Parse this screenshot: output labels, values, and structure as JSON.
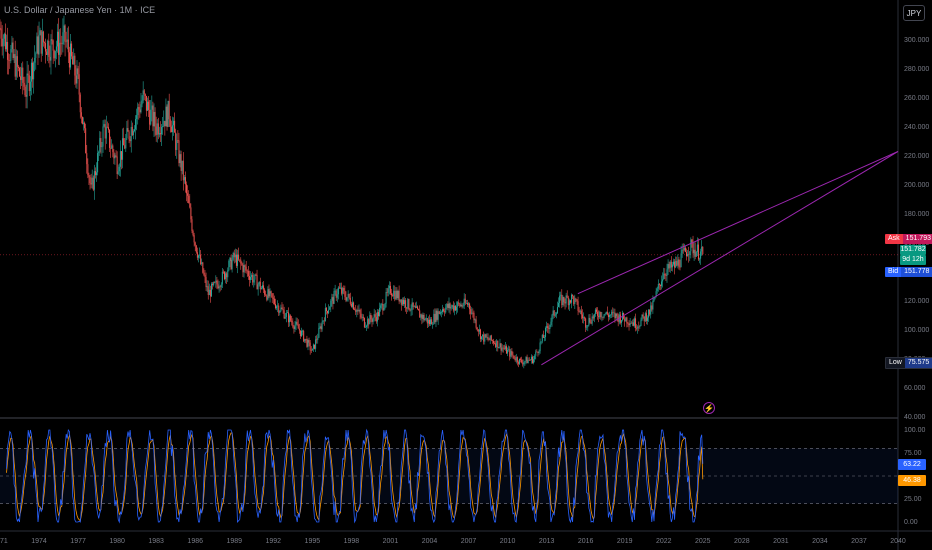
{
  "header": {
    "title": "U.S. Dollar / Japanese Yen · 1M · ICE",
    "currency_button": "JPY"
  },
  "colors": {
    "up": "#26a69a",
    "down": "#ef5350",
    "channel": "#9c27b0",
    "k_line": "#2962ff",
    "d_line": "#ff9800",
    "price_line": "#f23645"
  },
  "price_axis": {
    "labels": [
      "300.000",
      "280.000",
      "260.000",
      "240.000",
      "220.000",
      "200.000",
      "180.000",
      "160.000",
      "140.000",
      "120.000",
      "100.000",
      "80.000",
      "60.000",
      "40.000"
    ]
  },
  "tags": {
    "ask_label": "Ask",
    "ask_value": "151.793",
    "last_value": "151.782",
    "countdown": "9d 12h",
    "bid_label": "Bid",
    "bid_value": "151.778",
    "low_label": "Low",
    "low_value": "75.575"
  },
  "oscillator": {
    "labels": [
      "100.00",
      "75.00",
      "25.00",
      "0.00"
    ],
    "k_value": "63.22",
    "d_value": "46.38"
  },
  "time_axis": {
    "labels": [
      "1971",
      "1974",
      "1977",
      "1980",
      "1983",
      "1986",
      "1989",
      "1992",
      "1995",
      "1998",
      "2001",
      "2004",
      "2007",
      "2010",
      "2013",
      "2016",
      "2019",
      "2022",
      "2025",
      "2028",
      "2031",
      "2034",
      "2037",
      "2040"
    ]
  },
  "chart_data": {
    "type": "candlestick",
    "title": "U.S. Dollar / Japanese Yen · 1M · ICE",
    "ylim": [
      40,
      315
    ],
    "xlim": [
      1971,
      2040
    ],
    "x": [
      1971,
      1973,
      1974,
      1975,
      1976,
      1977,
      1978,
      1979,
      1980,
      1982,
      1983,
      1984,
      1985,
      1986,
      1987,
      1988,
      1989,
      1990,
      1991,
      1993,
      1994,
      1995,
      1996,
      1997,
      1998,
      1999,
      2000,
      2001,
      2002,
      2004,
      2005,
      2007,
      2008,
      2009,
      2010,
      2011,
      2012,
      2013,
      2014,
      2015,
      2016,
      2017,
      2018,
      2019,
      2020,
      2021,
      2022,
      2023,
      2024,
      2025
    ],
    "close": [
      308,
      265,
      300,
      295,
      300,
      270,
      195,
      240,
      215,
      260,
      240,
      250,
      210,
      160,
      125,
      135,
      150,
      140,
      130,
      110,
      100,
      85,
      112,
      128,
      120,
      105,
      110,
      128,
      120,
      105,
      115,
      118,
      95,
      92,
      85,
      78,
      80,
      100,
      120,
      122,
      105,
      112,
      110,
      108,
      104,
      113,
      140,
      145,
      158,
      151.8
    ],
    "channel": [
      {
        "from": [
          2012.6,
          76
        ],
        "to": [
          2040,
          223
        ]
      },
      {
        "from": [
          2015.4,
          125
        ],
        "to": [
          2040,
          223
        ]
      }
    ],
    "price_line": 151.782,
    "oscillator": {
      "name": "Stochastic RSI",
      "ylim": [
        0,
        100
      ],
      "bands": [
        80,
        50,
        20
      ],
      "k_last": 63.22,
      "d_last": 46.38
    }
  }
}
